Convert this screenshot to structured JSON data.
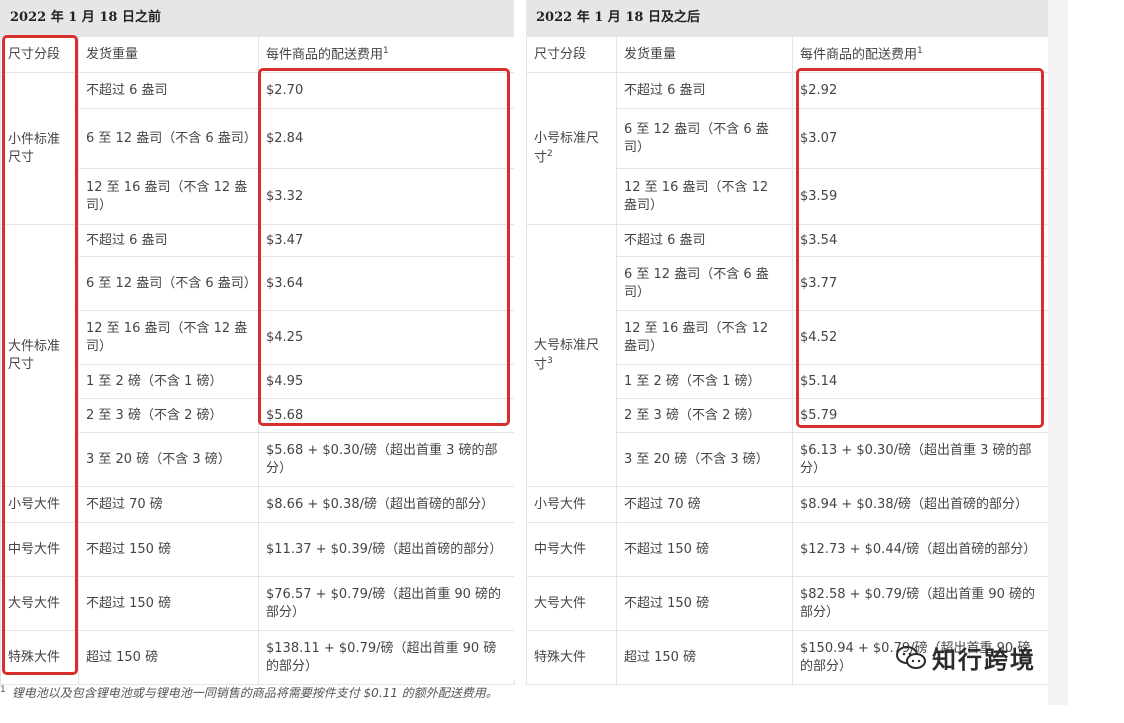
{
  "left": {
    "header": "2022 年 1 月 18 日之前",
    "columns": [
      "尺寸分段",
      "发货重量",
      "每件商品的配送费用"
    ],
    "fee_sup": "1",
    "tiers": {
      "small": "小件标准尺寸",
      "large": "大件标准尺寸",
      "small_oversize": "小号大件",
      "medium_oversize": "中号大件",
      "large_oversize": "大号大件",
      "special_oversize": "特殊大件"
    },
    "rows": [
      {
        "weight": "不超过 6 盎司",
        "fee": "$2.70"
      },
      {
        "weight": "6 至 12 盎司（不含 6 盎司）",
        "fee": "$2.84"
      },
      {
        "weight": "12 至 16 盎司（不含 12 盎司）",
        "fee": "$3.32"
      },
      {
        "weight": "不超过 6 盎司",
        "fee": "$3.47"
      },
      {
        "weight": "6 至 12 盎司（不含 6 盎司）",
        "fee": "$3.64"
      },
      {
        "weight": "12 至 16 盎司（不含 12 盎司）",
        "fee": "$4.25"
      },
      {
        "weight": "1 至 2 磅（不含 1 磅）",
        "fee": "$4.95"
      },
      {
        "weight": "2 至 3 磅（不含 2 磅）",
        "fee": "$5.68"
      },
      {
        "weight": "3 至 20 磅（不含 3 磅）",
        "fee": "$5.68 + $0.30/磅（超出首重 3 磅的部分）"
      },
      {
        "weight": "不超过 70 磅",
        "fee": "$8.66 + $0.38/磅（超出首磅的部分）"
      },
      {
        "weight": "不超过 150 磅",
        "fee": "$11.37 + $0.39/磅（超出首磅的部分）"
      },
      {
        "weight": "不超过 150 磅",
        "fee": "$76.57 + $0.79/磅（超出首重 90 磅的部分）"
      },
      {
        "weight": "超过 150 磅",
        "fee": "$138.11 + $0.79/磅（超出首重 90 磅的部分）"
      }
    ]
  },
  "right": {
    "header": "2022 年 1 月 18 日及之后",
    "columns": [
      "尺寸分段",
      "发货重量",
      "每件商品的配送费用"
    ],
    "fee_sup": "1",
    "tiers": {
      "small": "小号标准尺寸",
      "small_sup": "2",
      "large": "大号标准尺寸",
      "large_sup": "3",
      "small_oversize": "小号大件",
      "medium_oversize": "中号大件",
      "large_oversize": "大号大件",
      "special_oversize": "特殊大件"
    },
    "rows": [
      {
        "weight": "不超过 6 盎司",
        "fee": "$2.92"
      },
      {
        "weight": "6 至 12 盎司（不含 6 盎司）",
        "fee": "$3.07"
      },
      {
        "weight": "12 至 16 盎司（不含 12 盎司）",
        "fee": "$3.59"
      },
      {
        "weight": "不超过 6 盎司",
        "fee": "$3.54"
      },
      {
        "weight": "6 至 12 盎司（不含 6 盎司）",
        "fee": "$3.77"
      },
      {
        "weight": "12 至 16 盎司（不含 12 盎司）",
        "fee": "$4.52"
      },
      {
        "weight": "1 至 2 磅（不含 1 磅）",
        "fee": "$5.14"
      },
      {
        "weight": "2 至 3 磅（不含 2 磅）",
        "fee": "$5.79"
      },
      {
        "weight": "3 至 20 磅（不含 3 磅）",
        "fee": "$6.13 + $0.30/磅（超出首重 3 磅的部分）"
      },
      {
        "weight": "不超过 70 磅",
        "fee": "$8.94 + $0.38/磅（超出首磅的部分）"
      },
      {
        "weight": "不超过 150 磅",
        "fee": "$12.73 + $0.44/磅（超出首磅的部分）"
      },
      {
        "weight": "不超过 150 磅",
        "fee": "$82.58 + $0.79/磅（超出首重 90 磅的部分）"
      },
      {
        "weight": "超过 150 磅",
        "fee": "$150.94 + $0.79/磅（超出首重 90 磅的部分）"
      }
    ]
  },
  "footnote": {
    "num": "1",
    "text": "锂电池以及包含锂电池或与锂电池一同销售的商品将需要按件支付 $0.11 的额外配送费用。"
  },
  "watermark": "知行跨境",
  "colors": {
    "highlight": "#d6302c",
    "header_bg": "#e6e6e6",
    "grid": "#e4e4e4"
  }
}
